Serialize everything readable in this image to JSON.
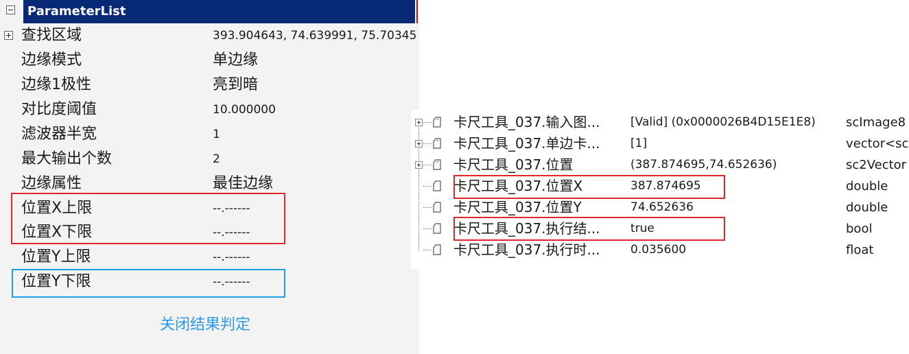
{
  "parameter_list": {
    "title": "ParameterList",
    "rows": [
      {
        "name": "查找区域",
        "value": "393.904643, 74.639991, 75.70345"
      },
      {
        "name": "边缘模式",
        "value": "单边缘"
      },
      {
        "name": "边缘1极性",
        "value": "亮到暗"
      },
      {
        "name": "对比度阈值",
        "value": "10.000000"
      },
      {
        "name": "滤波器半宽",
        "value": "1"
      },
      {
        "name": "最大输出个数",
        "value": "2"
      },
      {
        "name": "边缘属性",
        "value": "最佳边缘"
      },
      {
        "name": "位置X上限",
        "value": "--.------"
      },
      {
        "name": "位置X下限",
        "value": "--.------"
      },
      {
        "name": "位置Y上限",
        "value": "--.------"
      },
      {
        "name": "位置Y下限",
        "value": "--.------"
      }
    ],
    "close_link": "关闭结果判定",
    "colors": {
      "header": "#082a76",
      "highlight_red": "#e0262b",
      "highlight_blue": "#1c9ee0",
      "link": "#2b9be8"
    }
  },
  "variables": {
    "rows": [
      {
        "name": "卡尺工具_037.输入图...",
        "value": "[Valid] (0x0000026B4D15E1E8)",
        "type": "scImage8",
        "expandable": true
      },
      {
        "name": "卡尺工具_037.单边卡...",
        "value": "[1]",
        "type": "vector<sc",
        "expandable": true
      },
      {
        "name": "卡尺工具_037.位置",
        "value": "(387.874695,74.652636)",
        "type": "sc2Vector",
        "expandable": true
      },
      {
        "name": "卡尺工具_037.位置X",
        "value": "387.874695",
        "type": "double",
        "expandable": false
      },
      {
        "name": "卡尺工具_037.位置Y",
        "value": "74.652636",
        "type": "double",
        "expandable": false
      },
      {
        "name": "卡尺工具_037.执行结...",
        "value": "true",
        "type": "bool",
        "expandable": false
      },
      {
        "name": "卡尺工具_037.执行时...",
        "value": "0.035600",
        "type": "float",
        "expandable": false
      }
    ]
  }
}
